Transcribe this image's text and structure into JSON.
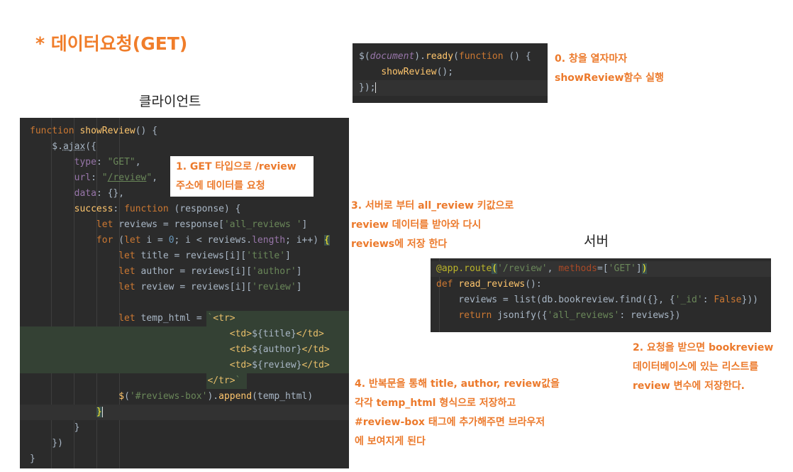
{
  "title": "* 데이터요청(GET)",
  "client_label": "클라이언트",
  "server_label": "서버",
  "notes": {
    "n0": [
      "0. 창을 열자마자",
      "showReview함수 실행"
    ],
    "n1": [
      "1. GET 타입으로 /review",
      "주소에 데이터를 요청"
    ],
    "n2": [
      "2. 요청을 받으면 bookreview",
      "데이터베이스에 있는 리스트를",
      "review 변수에 저장한다."
    ],
    "n3": [
      "3. 서버로 부터 all_review 키값으로",
      "review 데이터를 받아와 다시",
      "reviews에 저장 한다"
    ],
    "n4": [
      "4. 반복문을 통해 title, author, review값을",
      "각각 temp_html 형식으로 저장하고",
      "#review-box 태그에 추가해주면 브라우저",
      "에 보여지게 된다"
    ]
  },
  "code_ready": [
    "$(document).ready(function () {",
    "    showReview();",
    "});"
  ],
  "code_client": [
    "function showReview() {",
    "    $.ajax({",
    "        type: \"GET\",",
    "        url: \"/review\",",
    "        data: {},",
    "        success: function (response) {",
    "            let reviews = response['all_reviews ']",
    "            for (let i = 0; i < reviews.length; i++) {",
    "                let title = reviews[i]['title']",
    "                let author = reviews[i]['author']",
    "                let review = reviews[i]['review']",
    "",
    "                let temp_html = `<tr>",
    "                                    <td>${title}</td>",
    "                                    <td>${author}</td>",
    "                                    <td>${review}</td>",
    "                                </tr>`",
    "                $('#reviews-box').append(temp_html)",
    "            }",
    "        }",
    "    })",
    "}"
  ],
  "code_server": [
    "@app.route('/review', methods=['GET'])",
    "def read_reviews():",
    "    reviews = list(db.bookreview.find({}, {'_id': False}))",
    "    return jsonify({'all_reviews': reviews})"
  ],
  "colors": {
    "accent": "#f07d2a",
    "editor_bg": "#2b2b2b",
    "keyword": "#cc7832",
    "string": "#6a8759",
    "function": "#ffc66d"
  }
}
